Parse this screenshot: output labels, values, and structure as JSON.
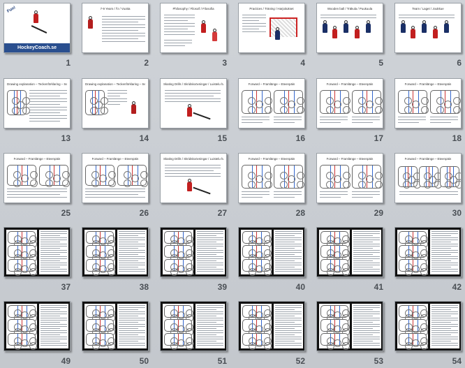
{
  "rows": [
    {
      "row": 1,
      "slides": [
        {
          "num": "1",
          "kind": "cover",
          "title": "",
          "brand": "HockeyCoach.se",
          "tag": "Fun!"
        },
        {
          "num": "2",
          "kind": "photo-text",
          "title": "7-9 Years / År / Vuotta"
        },
        {
          "num": "3",
          "kind": "text-photo",
          "title": "Philosophy / Filosofi / Filosofia"
        },
        {
          "num": "4",
          "kind": "text-goal",
          "title": "Practices / Träning / Harjoitukset"
        },
        {
          "num": "5",
          "kind": "photos",
          "title": "Wooden ball / Träkula / Puukuula"
        },
        {
          "num": "6",
          "kind": "photos",
          "title": "Team / Laget / Joukkue"
        }
      ]
    },
    {
      "row": 2,
      "slides": [
        {
          "num": "13",
          "kind": "drawing",
          "title": "Drawing explanation – Teckenförklaring – Selitys piirroksiin"
        },
        {
          "num": "14",
          "kind": "drawing2",
          "title": "Drawing explanation – Teckenförklaring – Selitys piirroksiin"
        },
        {
          "num": "15",
          "kind": "skating",
          "title": "Skating Drills / Skridskoövningar / Luistelu harjoituksia"
        },
        {
          "num": "16",
          "kind": "forward",
          "title": "Forward – Framlänge – Eteenpäin"
        },
        {
          "num": "17",
          "kind": "forward",
          "title": "Forward – Framlänge – Eteenpäin"
        },
        {
          "num": "18",
          "kind": "forward",
          "title": "Forward – Framlänge – Eteenpäin"
        }
      ]
    },
    {
      "row": 3,
      "slides": [
        {
          "num": "25",
          "kind": "forward-text",
          "title": "Forward – Framlänge – Eteenpäin"
        },
        {
          "num": "26",
          "kind": "forward-text",
          "title": "Forward – Framlänge – Eteenpäin"
        },
        {
          "num": "27",
          "kind": "skating",
          "title": "Skating Drills / Skridskoövningar / Luistelu harjoituksia"
        },
        {
          "num": "28",
          "kind": "forward",
          "title": "Forward – Framlänge – Eteenpäin"
        },
        {
          "num": "29",
          "kind": "forward",
          "title": "Forward – Framlänge – Eteenpäin"
        },
        {
          "num": "30",
          "kind": "forward3",
          "title": "Forward – Framlänge – Eteenpäin"
        }
      ]
    },
    {
      "row": 4,
      "slides": [
        {
          "num": "37",
          "kind": "scan",
          "title": ""
        },
        {
          "num": "38",
          "kind": "scan",
          "title": ""
        },
        {
          "num": "39",
          "kind": "scan",
          "title": ""
        },
        {
          "num": "40",
          "kind": "scan",
          "title": ""
        },
        {
          "num": "41",
          "kind": "scan",
          "title": ""
        },
        {
          "num": "42",
          "kind": "scan",
          "title": ""
        }
      ]
    },
    {
      "row": 5,
      "slides": [
        {
          "num": "49",
          "kind": "scan",
          "title": ""
        },
        {
          "num": "50",
          "kind": "scan",
          "title": ""
        },
        {
          "num": "51",
          "kind": "scan",
          "title": ""
        },
        {
          "num": "52",
          "kind": "scan",
          "title": ""
        },
        {
          "num": "53",
          "kind": "scan",
          "title": ""
        },
        {
          "num": "54",
          "kind": "scan",
          "title": ""
        }
      ]
    }
  ]
}
